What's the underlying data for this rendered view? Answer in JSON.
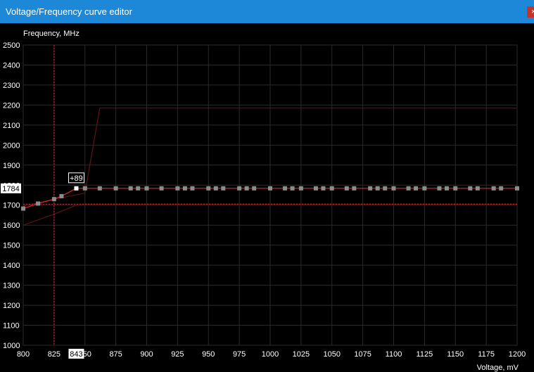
{
  "window": {
    "title": "Voltage/Frequency curve editor",
    "close_glyph": "×"
  },
  "colors": {
    "titlebar": "#1e88d8",
    "background": "#000000",
    "grid": "#2a2a2a",
    "curve": "#e0282a",
    "limit_curve": "#5c1516",
    "cursor": "#e02a2a",
    "point": "#8c8c8c",
    "selected_point": "#ffffff",
    "label": "#ffffff"
  },
  "chart_data": {
    "type": "line",
    "title": "",
    "xlabel": "Voltage, mV",
    "ylabel": "Frequency, MHz",
    "xlim": [
      800,
      1200
    ],
    "ylim": [
      1000,
      2500
    ],
    "x_ticks": [
      "800",
      "825",
      "850",
      "875",
      "900",
      "925",
      "950",
      "975",
      "1000",
      "1025",
      "1050",
      "1075",
      "1100",
      "1125",
      "1150",
      "1175",
      "1200"
    ],
    "y_ticks": [
      "2500",
      "2400",
      "2300",
      "2200",
      "2100",
      "2000",
      "1900",
      "1800",
      "1700",
      "1600",
      "1500",
      "1400",
      "1300",
      "1200",
      "1100",
      "1000"
    ],
    "grid": true,
    "series": [
      {
        "role": "vf-curve",
        "x": [
          800,
          812,
          825,
          831,
          843,
          850,
          862,
          875,
          887,
          893,
          900,
          912,
          925,
          931,
          937,
          950,
          956,
          962,
          975,
          981,
          987,
          1000,
          1012,
          1018,
          1025,
          1037,
          1043,
          1050,
          1062,
          1068,
          1081,
          1087,
          1093,
          1100,
          1112,
          1118,
          1125,
          1137,
          1143,
          1150,
          1162,
          1168,
          1181,
          1187,
          1200
        ],
        "y": [
          1683,
          1708,
          1730,
          1745,
          1784,
          1784,
          1784,
          1784,
          1784,
          1784,
          1784,
          1784,
          1784,
          1784,
          1784,
          1784,
          1784,
          1784,
          1784,
          1784,
          1784,
          1784,
          1784,
          1784,
          1784,
          1784,
          1784,
          1784,
          1784,
          1784,
          1784,
          1784,
          1784,
          1784,
          1784,
          1784,
          1784,
          1784,
          1784,
          1784,
          1784,
          1784,
          1784,
          1784,
          1784
        ]
      },
      {
        "role": "upper-limit-curve",
        "x": [
          800,
          825,
          850,
          862,
          1200
        ],
        "y": [
          1695,
          1730,
          1760,
          2185,
          2185
        ]
      },
      {
        "role": "base-curve",
        "x": [
          800,
          825,
          843,
          850,
          1200
        ],
        "y": [
          1600,
          1655,
          1700,
          1705,
          1705
        ]
      }
    ],
    "cursor": {
      "voltage_mV": 825,
      "frequency_MHz": 1705,
      "voltage_readout": "843",
      "frequency_readout": "1784"
    },
    "selected_point": {
      "x": 843,
      "y": 1784,
      "offset_label": "+89"
    }
  }
}
